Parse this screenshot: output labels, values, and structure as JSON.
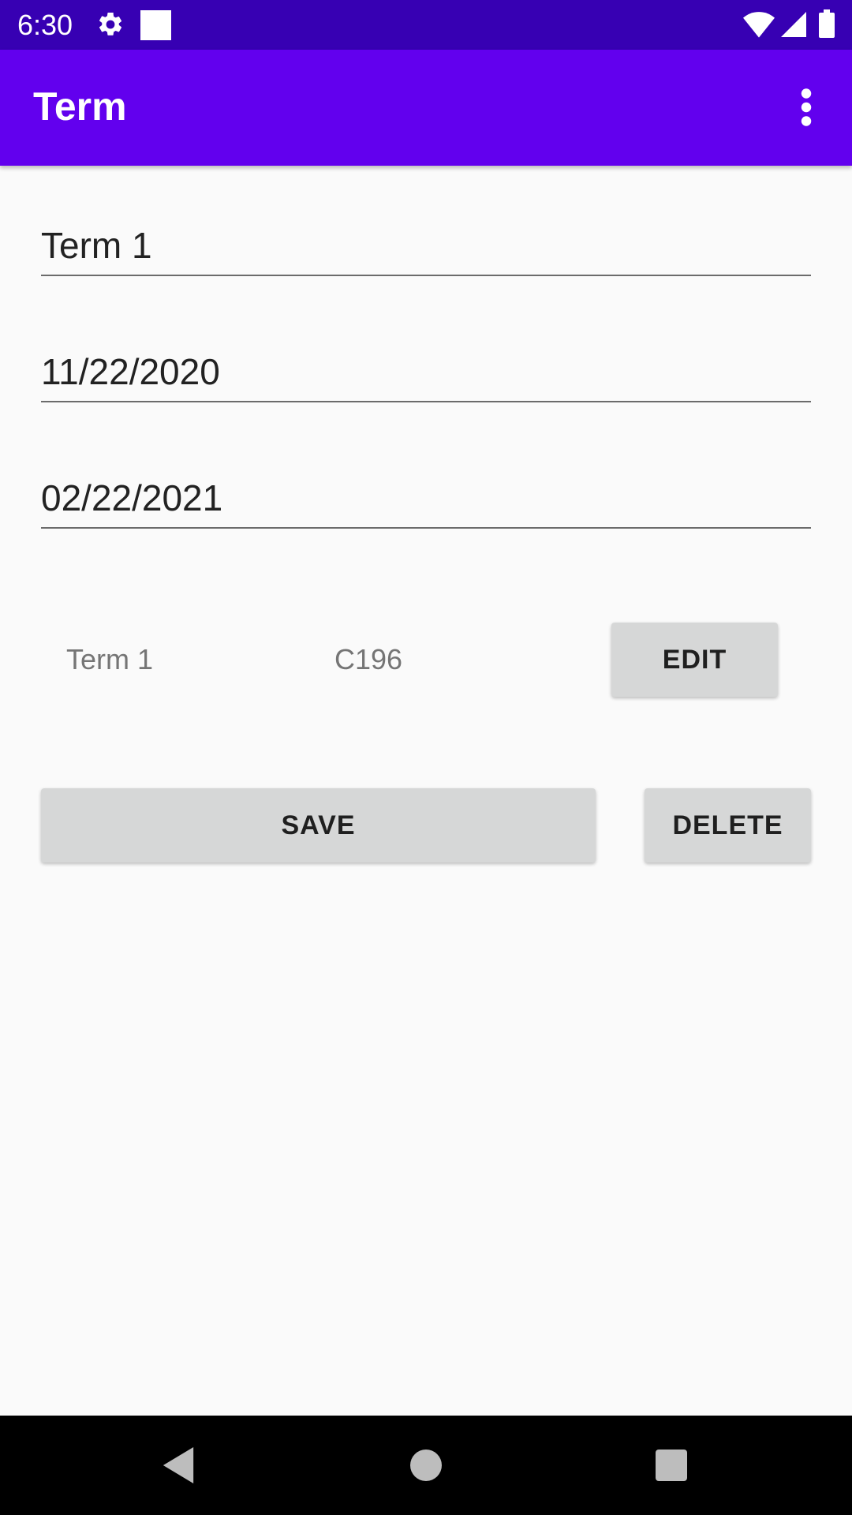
{
  "status_bar": {
    "time": "6:30",
    "icons": [
      "gear-icon",
      "square-notification-icon",
      "wifi-icon",
      "signal-icon",
      "battery-icon"
    ]
  },
  "app_bar": {
    "title": "Term",
    "overflow_icon": "more-vertical-icon"
  },
  "form": {
    "term_name": "Term 1",
    "start_date": "11/22/2020",
    "end_date": "02/22/2021"
  },
  "course_row": {
    "term": "Term 1",
    "course": "C196",
    "edit_label": "EDIT"
  },
  "actions": {
    "save_label": "SAVE",
    "delete_label": "DELETE"
  },
  "nav_bar": {
    "icons": [
      "back-icon",
      "home-icon",
      "recents-icon"
    ]
  },
  "colors": {
    "status_bar": "#3700b3",
    "app_bar": "#6200ee",
    "background": "#fafafa",
    "button": "#d6d7d7"
  }
}
